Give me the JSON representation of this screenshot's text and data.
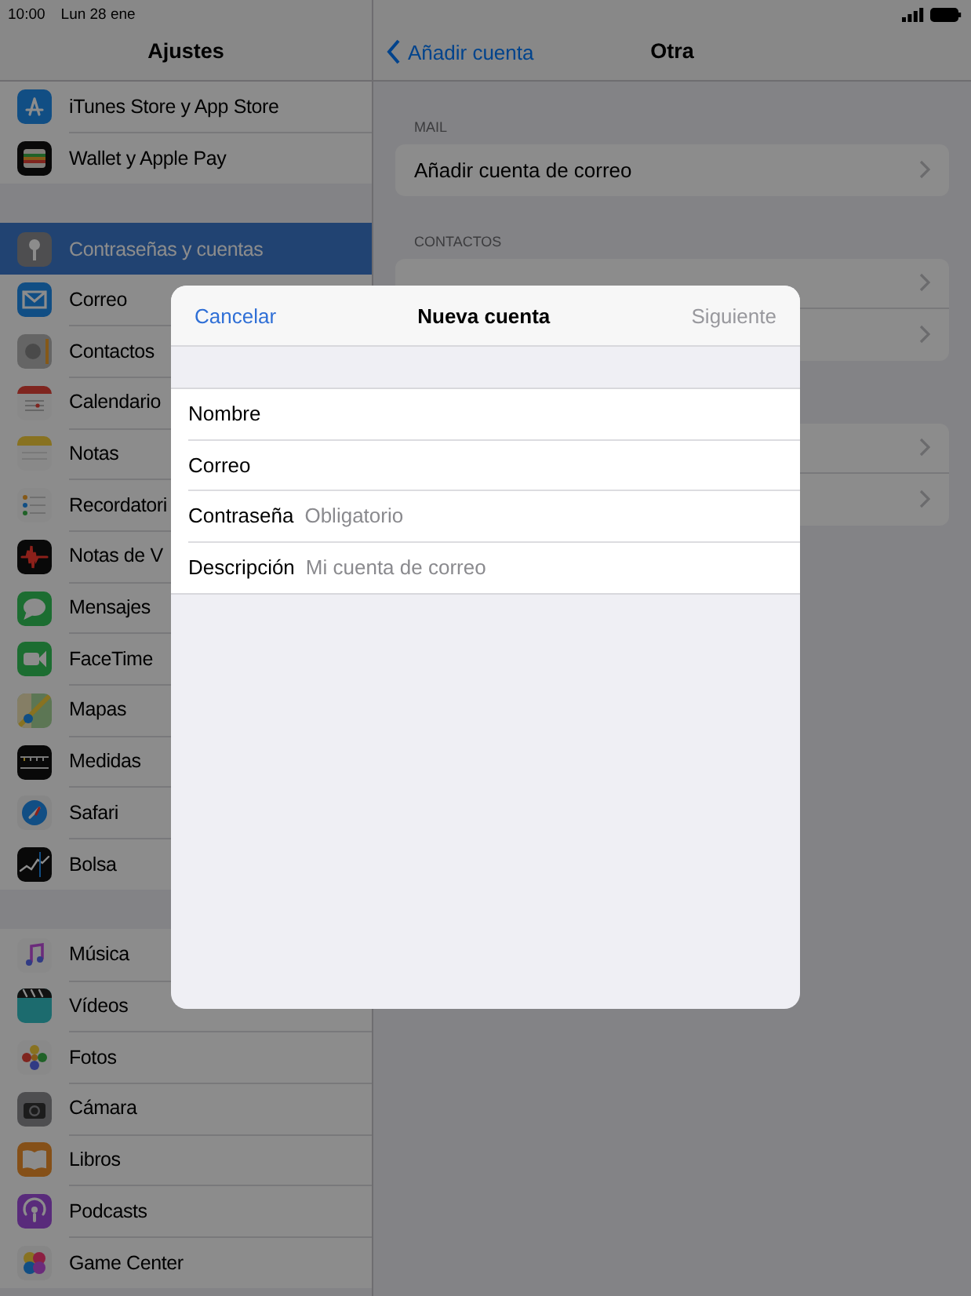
{
  "status_bar": {
    "time": "10:00",
    "date": "Lun 28 ene"
  },
  "sidebar": {
    "title": "Ajustes",
    "groups": [
      {
        "items": [
          {
            "label": "iTunes Store y App Store",
            "selected": false
          },
          {
            "label": "Wallet y Apple Pay",
            "selected": false
          }
        ]
      },
      {
        "items": [
          {
            "label": "Contraseñas y cuentas",
            "selected": true
          },
          {
            "label": "Correo",
            "selected": false
          },
          {
            "label": "Contactos",
            "selected": false
          },
          {
            "label": "Calendario",
            "selected": false
          },
          {
            "label": "Notas",
            "selected": false
          },
          {
            "label": "Recordatori",
            "selected": false
          },
          {
            "label": "Notas de V",
            "selected": false
          },
          {
            "label": "Mensajes",
            "selected": false
          },
          {
            "label": "FaceTime",
            "selected": false
          },
          {
            "label": "Mapas",
            "selected": false
          },
          {
            "label": "Medidas",
            "selected": false
          },
          {
            "label": "Safari",
            "selected": false
          },
          {
            "label": "Bolsa",
            "selected": false
          }
        ]
      },
      {
        "items": [
          {
            "label": "Música",
            "selected": false
          },
          {
            "label": "Vídeos",
            "selected": false
          },
          {
            "label": "Fotos",
            "selected": false
          },
          {
            "label": "Cámara",
            "selected": false
          },
          {
            "label": "Libros",
            "selected": false
          },
          {
            "label": "Podcasts",
            "selected": false
          },
          {
            "label": "Game Center",
            "selected": false
          }
        ]
      }
    ]
  },
  "detail": {
    "back": "Añadir cuenta",
    "title": "Otra",
    "sections": [
      {
        "header": "MAIL",
        "rows": [
          {
            "kind": "row",
            "label": "Añadir cuenta de correo"
          }
        ]
      },
      {
        "header": "CONTACTOS",
        "rows": [
          {
            "kind": "covered"
          },
          {
            "kind": "covered"
          }
        ]
      },
      {
        "rows": [
          {
            "kind": "covered"
          },
          {
            "kind": "covered"
          }
        ]
      }
    ]
  },
  "modal": {
    "cancel": "Cancelar",
    "title": "Nueva cuenta",
    "next": {
      "label": "Siguiente",
      "disabled": true
    },
    "fields": [
      {
        "label": "Nombre"
      },
      {
        "label": "Correo"
      },
      {
        "label": "Contraseña",
        "placeholder": "Obligatorio"
      },
      {
        "label": "Descripción",
        "placeholder": "Mi cuenta de correo"
      }
    ]
  }
}
